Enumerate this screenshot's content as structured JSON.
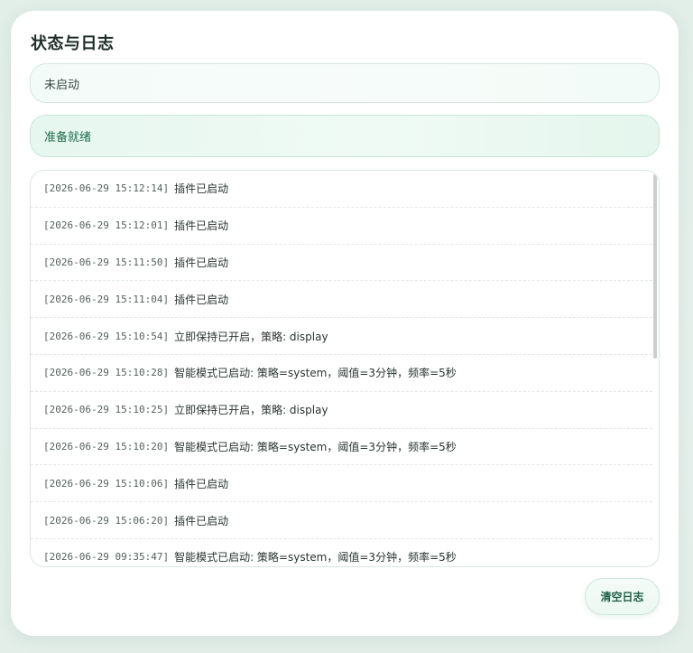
{
  "panel": {
    "title": "状态与日志",
    "status_text": "未启动",
    "ready_text": "准备就绪",
    "clear_button_label": "清空日志"
  },
  "logs": [
    {
      "time": "[2026-06-29 15:12:14]",
      "message": "插件已启动"
    },
    {
      "time": "[2026-06-29 15:12:01]",
      "message": "插件已启动"
    },
    {
      "time": "[2026-06-29 15:11:50]",
      "message": "插件已启动"
    },
    {
      "time": "[2026-06-29 15:11:04]",
      "message": "插件已启动"
    },
    {
      "time": "[2026-06-29 15:10:54]",
      "message": "立即保持已开启，策略: display"
    },
    {
      "time": "[2026-06-29 15:10:28]",
      "message": "智能模式已启动: 策略=system，阈值=3分钟，频率=5秒"
    },
    {
      "time": "[2026-06-29 15:10:25]",
      "message": "立即保持已开启，策略: display"
    },
    {
      "time": "[2026-06-29 15:10:20]",
      "message": "智能模式已启动: 策略=system，阈值=3分钟，频率=5秒"
    },
    {
      "time": "[2026-06-29 15:10:06]",
      "message": "插件已启动"
    },
    {
      "time": "[2026-06-29 15:06:20]",
      "message": "插件已启动"
    },
    {
      "time": "[2026-06-29 09:35:47]",
      "message": "智能模式已启动: 策略=system，阈值=3分钟，频率=5秒"
    }
  ],
  "colors": {
    "accent": "#1f6b4d",
    "ready_background": "#e6f7ef",
    "page_background": "#e3efe9"
  }
}
